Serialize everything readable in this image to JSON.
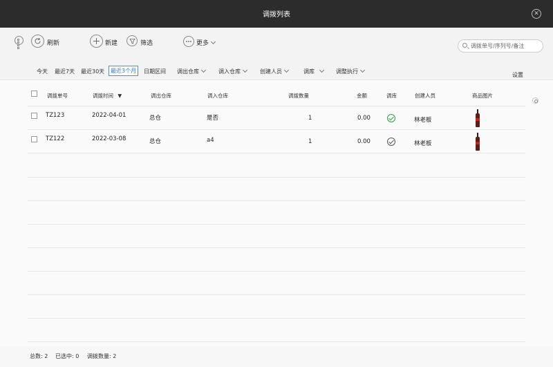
{
  "window": {
    "title": "调拨列表"
  },
  "toolbar": {
    "refresh_label": "刷新",
    "new_label": "新建",
    "filter_label": "筛选",
    "more_label": "更多",
    "search_placeholder": "调拨单号/序列号/备注"
  },
  "filters": {
    "today": "今天",
    "last7": "最近7天",
    "last30": "最近30天",
    "last3m": "最近3个月",
    "date_range": "日期区间",
    "out_warehouse": "调出仓库",
    "in_warehouse": "调入仓库",
    "creator": "创建人员",
    "transfer": "调库",
    "adjust": "调整执行",
    "settings": "设置"
  },
  "table": {
    "columns": {
      "order_no": "调拨单号",
      "time": "调拨时间",
      "sort_indicator": "▼",
      "out_warehouse": "调出仓库",
      "in_warehouse": "调入仓库",
      "qty": "调拨数量",
      "amount": "金额",
      "transfer": "调库",
      "creator": "创建人员",
      "image": "商品图片"
    },
    "rows": [
      {
        "order_no": "TZ123",
        "time": "2022-04-01",
        "out_warehouse": "总仓",
        "in_warehouse": "是否",
        "qty": "1",
        "amount": "0.00",
        "transfer_status": "check-green",
        "creator": "林老板",
        "image": "cola-bottle"
      },
      {
        "order_no": "TZ122",
        "time": "2022-03-08",
        "out_warehouse": "总仓",
        "in_warehouse": "a4",
        "qty": "1",
        "amount": "0.00",
        "transfer_status": "check-gray",
        "creator": "林老板",
        "image": "cola-bottle"
      }
    ]
  },
  "footer": {
    "total": "总数:  2",
    "selected": "已选中:  0",
    "transfer_qty": "调拨数量:  2"
  }
}
